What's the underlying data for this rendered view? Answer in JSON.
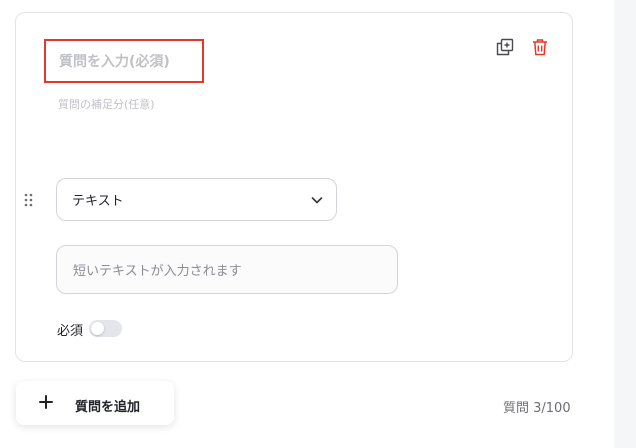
{
  "question": {
    "title_placeholder": "質問を入力(必須)",
    "supplement_placeholder": "質問の補足分(任意)",
    "type_select": {
      "selected": "テキスト",
      "icon": "chevron-down-icon"
    },
    "answer_preview_placeholder": "短いテキストが入力されます",
    "required": {
      "label": "必須",
      "enabled": false
    },
    "actions": {
      "copy_icon": "duplicate-icon",
      "delete_icon": "trash-icon"
    },
    "drag_icon": "drag-handle-icon"
  },
  "footer": {
    "add_question_label": "質問を追加",
    "add_icon": "plus-icon",
    "question_count": "質問 3/100"
  },
  "colors": {
    "highlight_border": "#e5382a",
    "delete_icon": "#e5382a",
    "placeholder_text": "#c0c1c8",
    "border": "#d4d5db"
  }
}
